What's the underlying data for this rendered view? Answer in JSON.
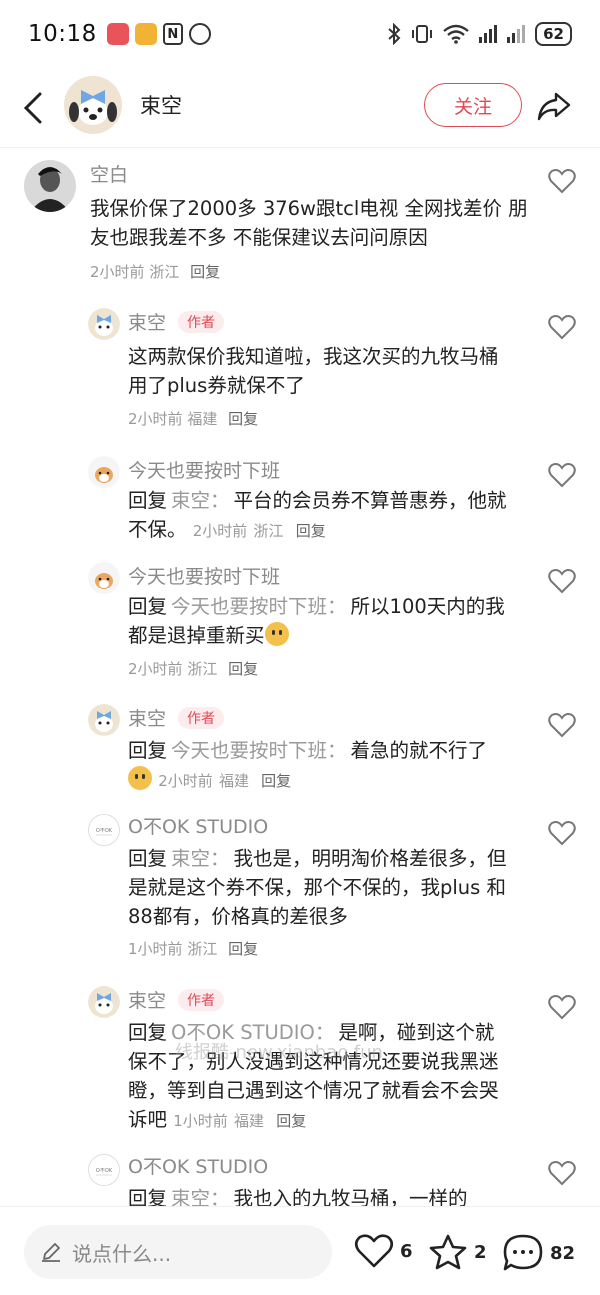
{
  "status_bar": {
    "time": "10:18",
    "battery": "62"
  },
  "header": {
    "name": "束空",
    "follow_label": "关注"
  },
  "comments": [
    {
      "name": "空白",
      "text": "我保价保了2000多 376w跟tcl电视 全网找差价 朋友也跟我差不多 不能保建议去问问原因",
      "time": "2小时前",
      "location": "浙江",
      "reply_label": "回复"
    },
    {
      "name": "束空",
      "tag": "作者",
      "text": "这两款保价我知道啦，我这次买的九牧马桶用了plus券就保不了",
      "time": "2小时前",
      "location": "福建",
      "reply_label": "回复"
    },
    {
      "name": "今天也要按时下班",
      "reply_prefix": "回复",
      "reply_target": "束空：",
      "text": "平台的会员券不算普惠券，他就不保。",
      "time": "2小时前",
      "location": "浙江",
      "reply_label": "回复"
    },
    {
      "name": "今天也要按时下班",
      "reply_prefix": "回复",
      "reply_target": "今天也要按时下班：",
      "text": "所以100天内的我都是退掉重新买",
      "time": "2小时前",
      "location": "浙江",
      "reply_label": "回复"
    },
    {
      "name": "束空",
      "tag": "作者",
      "reply_prefix": "回复",
      "reply_target": "今天也要按时下班：",
      "text": "着急的就不行了",
      "time": "2小时前",
      "location": "福建",
      "reply_label": "回复"
    },
    {
      "name": "O不OK STUDIO",
      "reply_prefix": "回复",
      "reply_target": "束空：",
      "text": "我也是，明明淘价格差很多，但是就是这个券不保，那个不保的，我plus 和88都有，价格真的差很多",
      "time": "1小时前",
      "location": "浙江",
      "reply_label": "回复"
    },
    {
      "name": "束空",
      "tag": "作者",
      "reply_prefix": "回复",
      "reply_target": "O不OK STUDIO：",
      "text": "是啊，碰到这个就保不了，别人没遇到这种情况还要说我黑迷瞪，等到自己遇到这个情况了就看会不会哭诉吧",
      "time": "1小时前",
      "location": "福建",
      "reply_label": "回复"
    },
    {
      "name": "O不OK STUDIO",
      "reply_prefix": "回复",
      "reply_target": "束空：",
      "text": "我也入的九牧马桶，一样的"
    }
  ],
  "watermark": "线报酷-new.xianbao.fun",
  "bottom_bar": {
    "input_placeholder": "说点什么...",
    "likes": "6",
    "collects": "2",
    "comments": "82"
  }
}
